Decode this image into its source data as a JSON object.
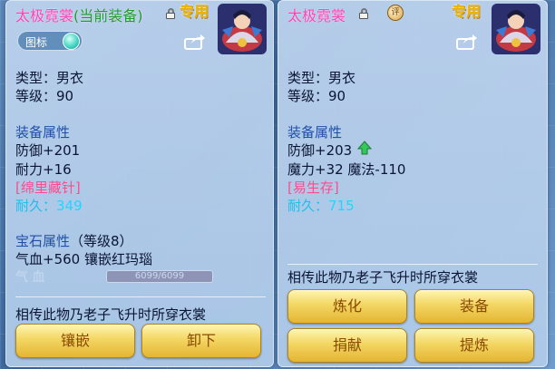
{
  "left_panel": {
    "item_name": "太极霓裳",
    "equipped_tag": "(当前装备)",
    "special_tag": "专用",
    "icon_toggle_label": "图标",
    "type_line": "类型：男衣",
    "level_line": "等级：90",
    "attr_title": "装备属性",
    "defense_line": "防御+201",
    "stamina_line": "耐力+16",
    "special_effect": "[绵里藏针]",
    "durability_label": "耐久：",
    "durability_value": "349",
    "gem_title": "宝石属性",
    "gem_level": "（等级8）",
    "gem_line": "气血+560 镶嵌红玛瑙",
    "ghost_hp_label": "气 血",
    "ghost_hp_value": "6099/6099",
    "description": "相传此物乃老子飞升时所穿衣裳",
    "buttons": {
      "inlay": "镶嵌",
      "unequip": "卸下"
    }
  },
  "right_panel": {
    "item_name": "太极霓裳",
    "medal_text": "评",
    "special_tag": "专用",
    "type_line": "类型：男衣",
    "level_line": "等级：90",
    "attr_title": "装备属性",
    "defense_line": "防御+203",
    "magic_line": "魔力+32 魔法-110",
    "special_effect": "[易生存]",
    "durability_label": "耐久：",
    "durability_value": "715",
    "description": "相传此物乃老子飞升时所穿衣裳",
    "buttons": {
      "refine": "炼化",
      "equip": "装备",
      "donate": "捐献",
      "extract": "提炼"
    }
  },
  "colors": {
    "item_name": "#ff3fb5",
    "equipped": "#1e9b2c",
    "section": "#1f4fa8",
    "special_effect": "#ff4b8d",
    "durability": "#1dd7ff",
    "button_text": "#8a4a00"
  }
}
